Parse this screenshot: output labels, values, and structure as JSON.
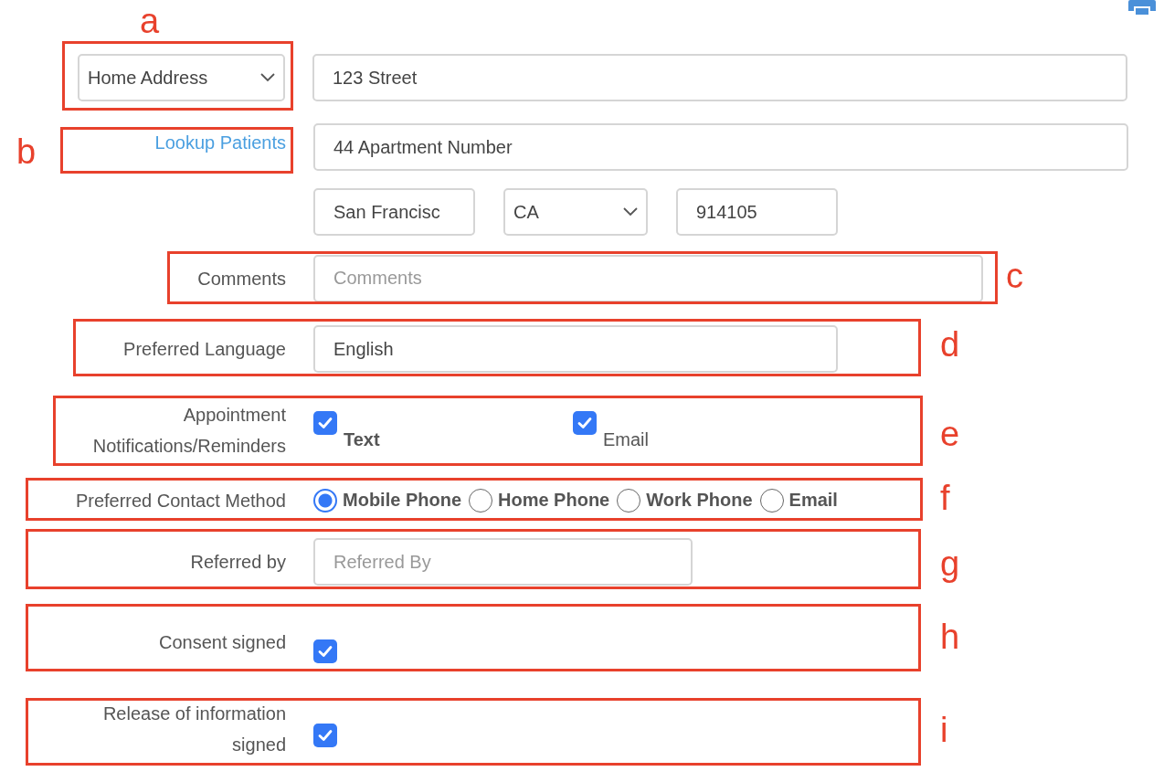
{
  "sections": [
    {
      "annotation": "a",
      "kind": "address",
      "address_type": "Home Address",
      "value": "123 Street"
    },
    {
      "annotation": "b",
      "kind": "link_row",
      "link": "Lookup Patients",
      "value": "44 Apartment Number"
    },
    {
      "kind": "city_row",
      "city": "San Francisc",
      "state": "CA",
      "zip": "914105"
    },
    {
      "annotation": "c",
      "kind": "text",
      "label": "Comments",
      "placeholder": "Comments"
    },
    {
      "annotation": "d",
      "kind": "text",
      "label": "Preferred Language",
      "value": "English"
    },
    {
      "annotation": "e",
      "kind": "checks",
      "label": "Appointment Notifications/Reminders",
      "options": [
        {
          "label": "Text",
          "checked": true,
          "bold": true
        },
        {
          "label": "Email",
          "checked": true,
          "bold": false
        }
      ]
    },
    {
      "annotation": "f",
      "kind": "radios",
      "label": "Preferred Contact Method",
      "options": [
        {
          "label": "Mobile Phone",
          "selected": true
        },
        {
          "label": "Home Phone",
          "selected": false
        },
        {
          "label": "Work Phone",
          "selected": false
        },
        {
          "label": "Email",
          "selected": false
        }
      ]
    },
    {
      "annotation": "g",
      "kind": "text",
      "label": "Referred by",
      "placeholder": "Referred By"
    },
    {
      "annotation": "h",
      "kind": "check",
      "label": "Consent signed",
      "checked": true
    },
    {
      "annotation": "i",
      "kind": "check",
      "label": "Release of information signed",
      "checked": true
    }
  ]
}
